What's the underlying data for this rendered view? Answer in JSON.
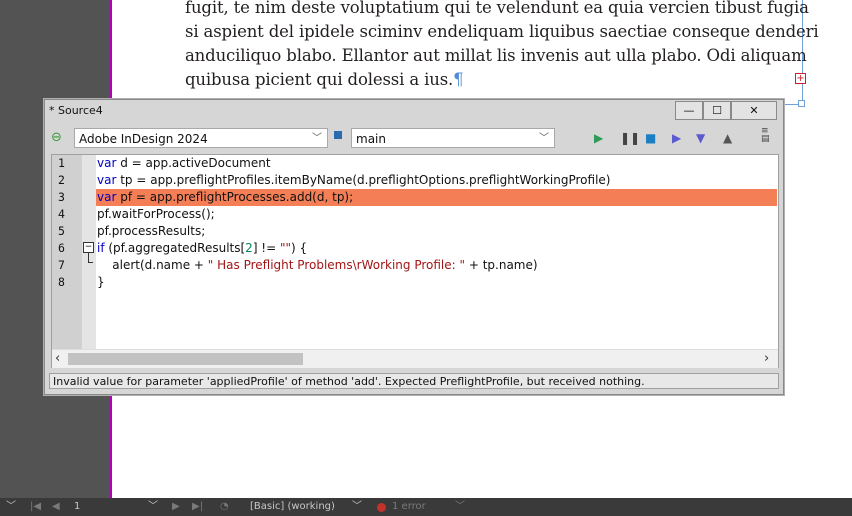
{
  "document": {
    "text_lines": [
      "fugit, te nim deste voluptatium qui te velendunt ea quia vercien tibust fugia",
      "si aspient del ipidele sciminv endeliquam liquibus saectiae conseque denderi",
      "anduciliquo blabo. Ellantor aut millat lis invenis aut ulla plabo. Odi aliquam",
      "quibusa picient qui dolessi a ius."
    ],
    "pilcrow": "¶",
    "overset_marker": "+"
  },
  "panel": {
    "title": "* Source4",
    "buttons": {
      "minimize": "—",
      "maximize": "☐",
      "close": "✕"
    },
    "target_app": "Adobe InDesign 2024",
    "engine": "main",
    "toolbar_icons": [
      "link-icon",
      "engine-icon",
      "run-icon",
      "pause-icon",
      "stop-icon",
      "step-over-icon",
      "step-into-icon",
      "step-out-icon",
      "panel-menu-icon"
    ],
    "line_numbers": [
      "1",
      "2",
      "3",
      "4",
      "5",
      "6",
      "7",
      "8"
    ],
    "code": [
      [
        [
          "kw",
          "var"
        ],
        [
          "",
          "  d = app.activeDocument"
        ]
      ],
      [
        [
          "kw",
          "var"
        ],
        [
          "",
          "  tp = app.preflightProfiles.itemByName(d.preflightOptions.preflightWorkingProfile)"
        ]
      ],
      [
        [
          "kw",
          "var"
        ],
        [
          "",
          "  pf = app.preflightProcesses.add(d, tp);"
        ]
      ],
      [
        [
          "",
          "pf.waitForProcess();"
        ]
      ],
      [
        [
          "",
          "pf.processResults;"
        ]
      ],
      [
        [
          "kw",
          "if"
        ],
        [
          "",
          " (pf.aggregatedResults["
        ],
        [
          "num",
          "2"
        ],
        [
          "",
          "] != "
        ],
        [
          "str",
          "\"\""
        ],
        [
          "",
          ") {"
        ]
      ],
      [
        [
          "",
          "    alert(d.name + "
        ],
        [
          "str",
          "\" Has Preflight Problems\\rWorking Profile: \""
        ],
        [
          "",
          " + tp.name)"
        ]
      ],
      [
        [
          "",
          "}"
        ]
      ]
    ],
    "highlighted_line": 3,
    "error_message": "Invalid value for parameter 'appliedProfile' of method 'add'. Expected PreflightProfile, but received nothing."
  },
  "statusbar": {
    "page_number": "1",
    "preflight_profile": "[Basic] (working)",
    "errors": "1 error"
  },
  "colors": {
    "highlight": "#f47f56",
    "keyword": "#0000c8",
    "string": "#a31515",
    "error_dot": "#c4332b"
  }
}
